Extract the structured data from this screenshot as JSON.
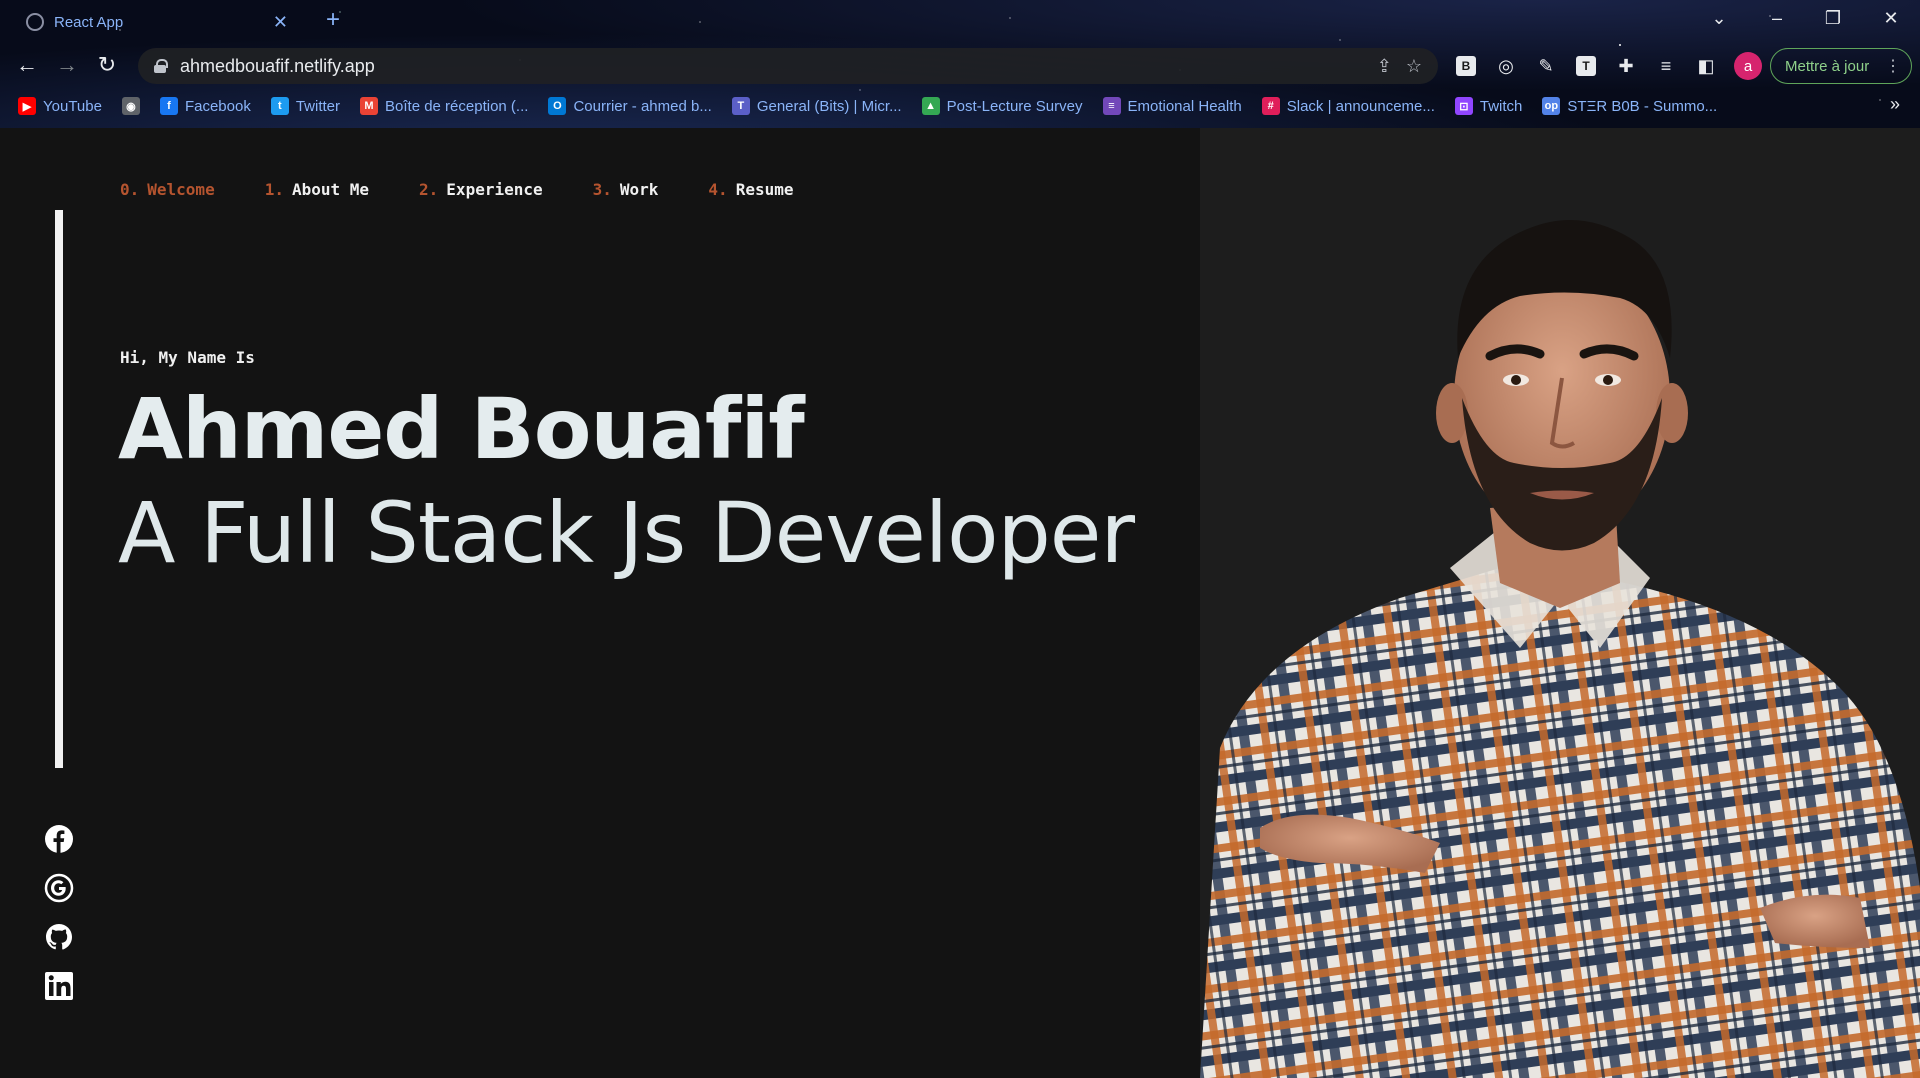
{
  "browser": {
    "tab_title": "React App",
    "url": "ahmedbouafif.netlify.app",
    "update_button": "Mettre à jour",
    "avatar_letter": "a",
    "bookmarks": [
      {
        "label": "YouTube",
        "icon": "youtube-icon",
        "color": "#ff0000"
      },
      {
        "label": "",
        "icon": "globe-icon",
        "color": "#5f6368"
      },
      {
        "label": "Facebook",
        "icon": "facebook-icon",
        "color": "#1877f2"
      },
      {
        "label": "Twitter",
        "icon": "twitter-icon",
        "color": "#1d9bf0"
      },
      {
        "label": "Boîte de réception (...",
        "icon": "gmail-icon",
        "color": "#ea4335"
      },
      {
        "label": "Courrier - ahmed b...",
        "icon": "outlook-icon",
        "color": "#0078d4"
      },
      {
        "label": "General (Bits) | Micr...",
        "icon": "teams-icon",
        "color": "#5b5fc7"
      },
      {
        "label": "Post-Lecture Survey",
        "icon": "drive-icon",
        "color": "#34a853"
      },
      {
        "label": "Emotional Health",
        "icon": "forms-icon",
        "color": "#7248b9"
      },
      {
        "label": "Slack | announceme...",
        "icon": "slack-icon",
        "color": "#e01e5a"
      },
      {
        "label": "Twitch",
        "icon": "twitch-icon",
        "color": "#9146ff"
      },
      {
        "label": "STΞR B0B - Summo...",
        "icon": "opgg-icon",
        "color": "#5383e8"
      }
    ]
  },
  "nav": [
    {
      "num": "0.",
      "label": "Welcome",
      "active": true
    },
    {
      "num": "1.",
      "label": "About Me"
    },
    {
      "num": "2.",
      "label": "Experience"
    },
    {
      "num": "3.",
      "label": "Work"
    },
    {
      "num": "4.",
      "label": "Resume"
    }
  ],
  "hero": {
    "greeting": "Hi, My Name Is",
    "name": "Ahmed Bouafif",
    "role": "A Full Stack Js Developer"
  },
  "socials": [
    "facebook-icon",
    "google-icon",
    "github-icon",
    "linkedin-icon"
  ],
  "colors": {
    "accent": "#b5542f",
    "page_bg": "#131313",
    "text": "#e4ecee"
  }
}
